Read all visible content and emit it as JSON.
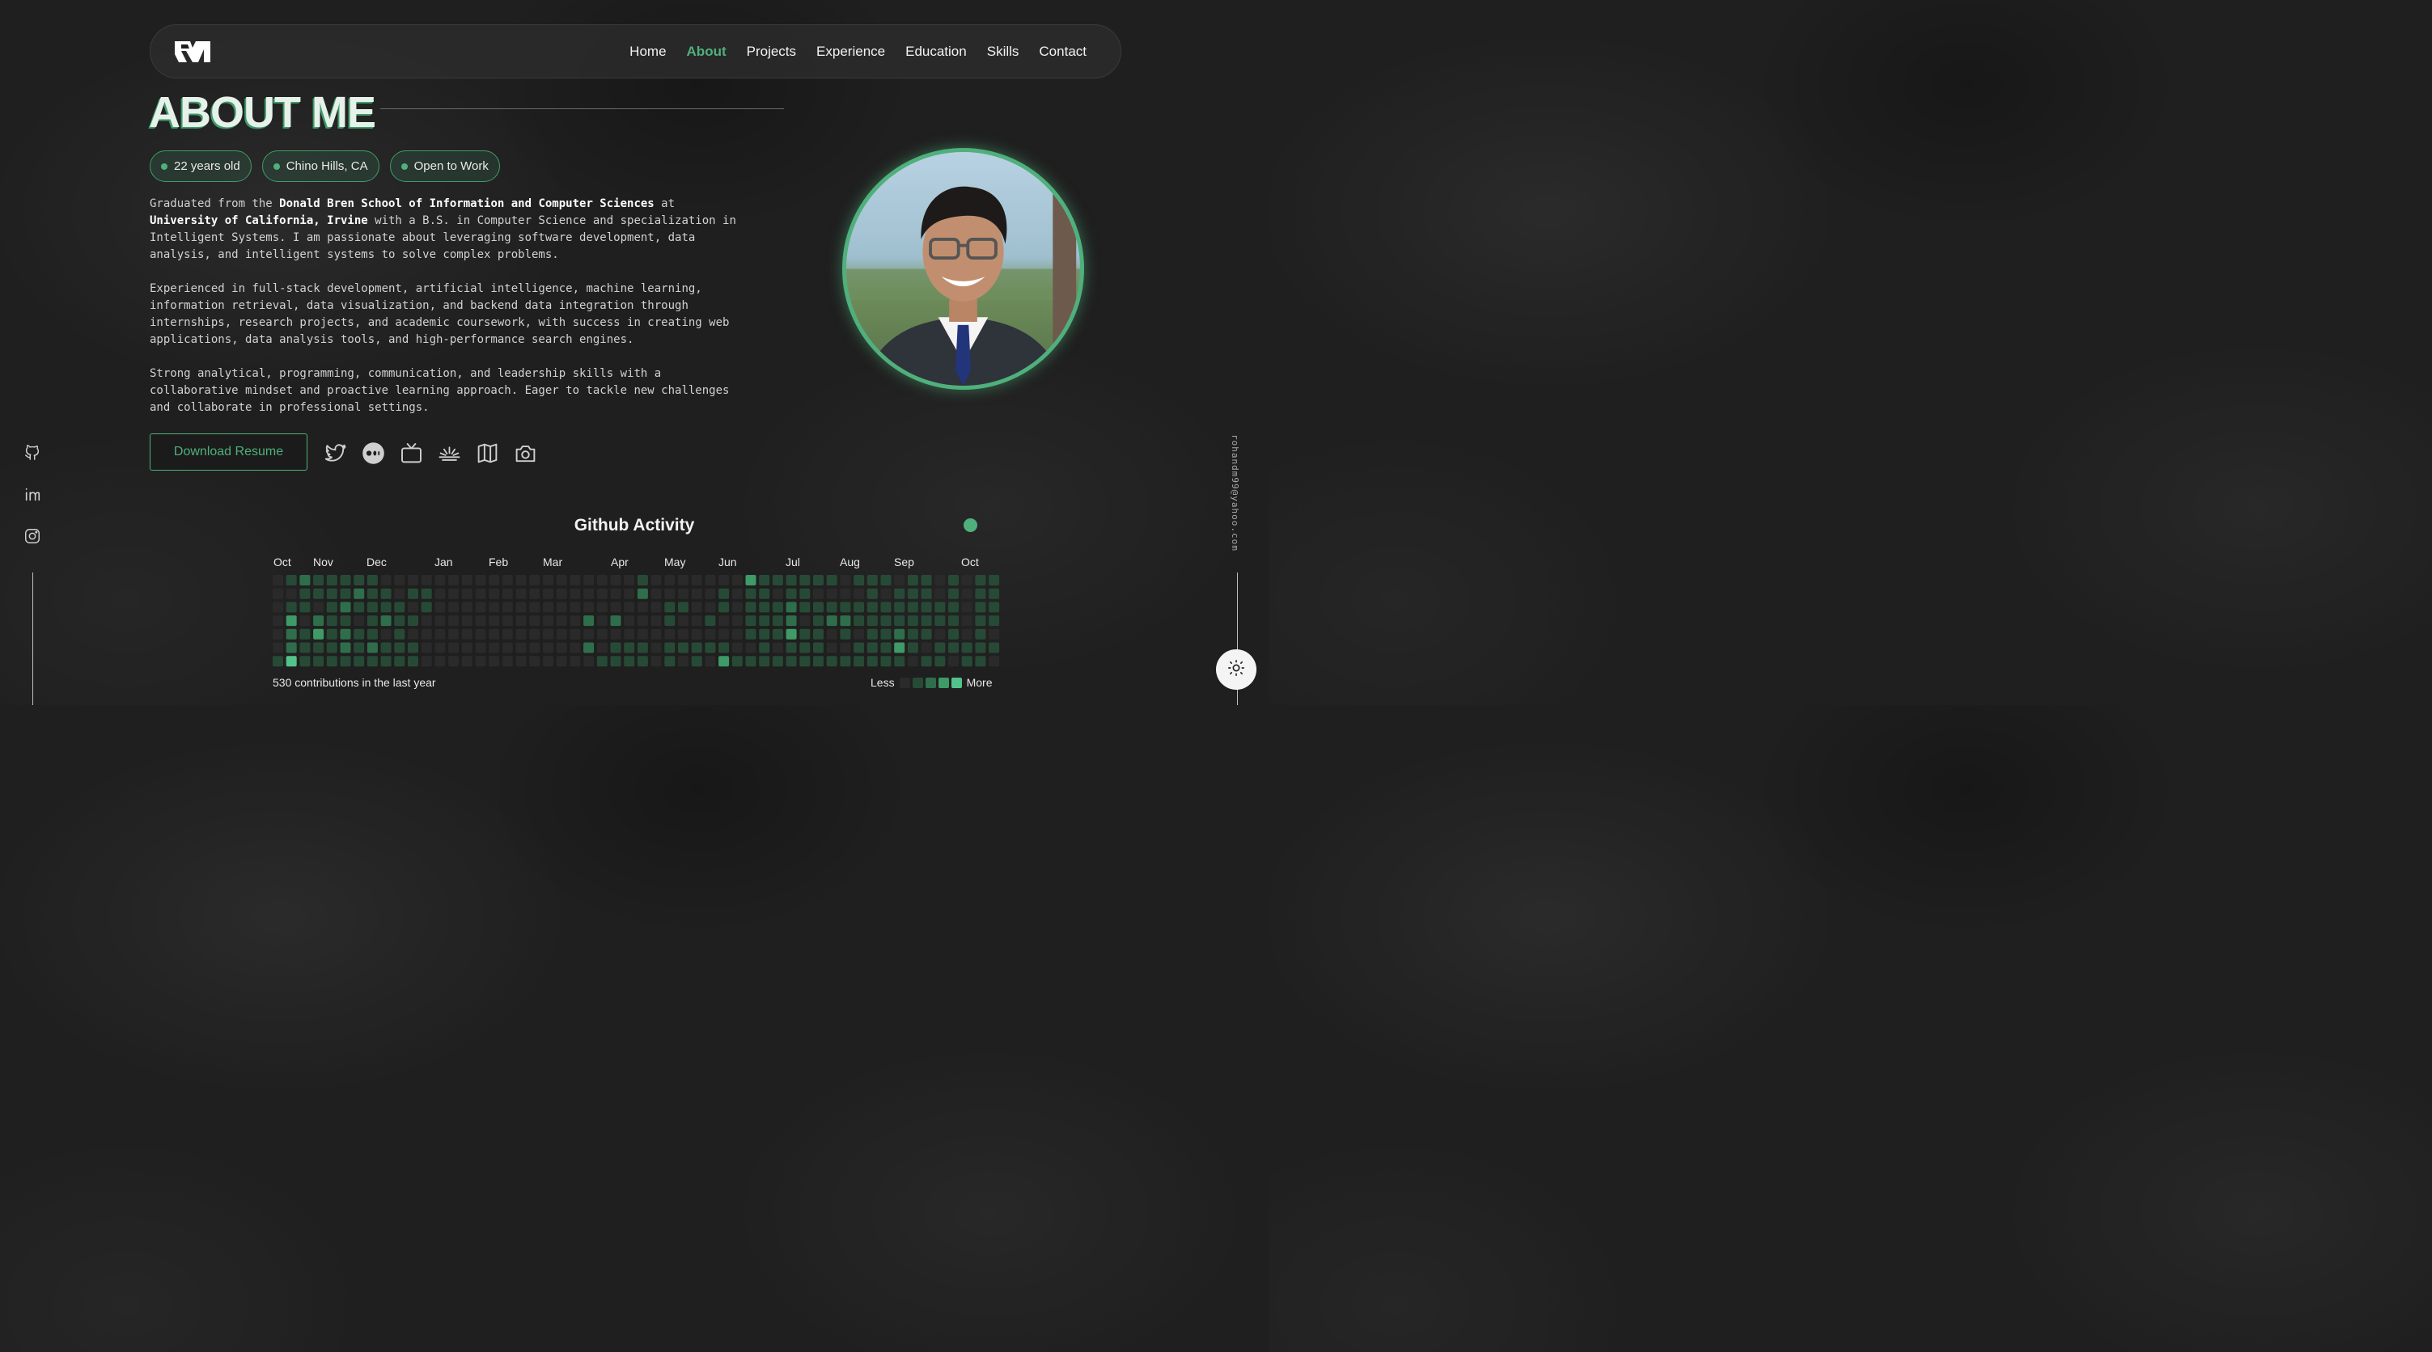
{
  "nav": {
    "logo_icon": "rm-monogram-logo",
    "links": [
      {
        "label": "Home",
        "active": false
      },
      {
        "label": "About",
        "active": true
      },
      {
        "label": "Projects",
        "active": false
      },
      {
        "label": "Experience",
        "active": false
      },
      {
        "label": "Education",
        "active": false
      },
      {
        "label": "Skills",
        "active": false
      },
      {
        "label": "Contact",
        "active": false
      }
    ]
  },
  "about": {
    "title": "ABOUT ME",
    "badges": [
      "22 years old",
      "Chino Hills, CA",
      "Open to Work"
    ],
    "paragraph1": {
      "t1": "Graduated from the ",
      "b1": "Donald Bren School of Information and Computer Sciences",
      "t2": " at\n",
      "b2": "University of California, Irvine",
      "t3": " with a B.S. in Computer Science and specialization in\nIntelligent Systems. I am passionate about leveraging software development, data\nanalysis, and intelligent systems to solve complex problems."
    },
    "paragraph2": "Experienced in full-stack development, artificial intelligence, machine learning,\ninformation retrieval, data visualization, and backend data integration through\ninternships, research projects, and academic coursework, with success in creating web\napplications, data analysis tools, and high-performance search engines.",
    "paragraph3": "Strong analytical, programming, communication, and leadership skills with a\ncollaborative mindset and proactive learning approach. Eager to tackle new challenges\nand collaborate in professional settings.",
    "resume_button": "Download Resume",
    "profile_icons": [
      "twitter-icon",
      "medium-icon",
      "tv-icon",
      "sunrise-icon",
      "map-icon",
      "camera-icon"
    ],
    "photo_alt": "profile-photo"
  },
  "sidebar": {
    "icons": [
      "github-icon",
      "linkedin-icon",
      "instagram-icon"
    ],
    "email": "rohandm99@yahoo.com"
  },
  "theme_toggle_icon": "sun-icon",
  "github": {
    "title": "Github Activity",
    "months": [
      "Oct",
      "Nov",
      "Dec",
      "Jan",
      "Feb",
      "Mar",
      "Apr",
      "May",
      "Jun",
      "Jul",
      "Aug",
      "Sep",
      "Oct"
    ],
    "total_label": "530 contributions in the last year",
    "legend_less": "Less",
    "legend_more": "More",
    "colors": [
      "#2a2a2a",
      "#274a37",
      "#2f6e4b",
      "#3e9a66",
      "#52c48a"
    ],
    "weeks": [
      [
        0,
        0,
        0,
        0,
        0,
        0,
        1
      ],
      [
        1,
        0,
        1,
        3,
        2,
        2,
        4
      ],
      [
        2,
        1,
        1,
        0,
        1,
        1,
        1
      ],
      [
        1,
        1,
        0,
        2,
        3,
        1,
        1
      ],
      [
        1,
        1,
        1,
        1,
        1,
        1,
        1
      ],
      [
        1,
        1,
        2,
        1,
        2,
        2,
        1
      ],
      [
        1,
        2,
        1,
        0,
        1,
        1,
        1
      ],
      [
        1,
        1,
        1,
        1,
        1,
        2,
        1
      ],
      [
        0,
        1,
        1,
        2,
        0,
        1,
        1
      ],
      [
        0,
        0,
        1,
        1,
        1,
        1,
        1
      ],
      [
        0,
        1,
        0,
        1,
        0,
        1,
        1
      ],
      [
        0,
        1,
        1,
        0,
        0,
        0,
        0
      ],
      [
        0,
        0,
        0,
        0,
        0,
        0,
        0
      ],
      [
        0,
        0,
        0,
        0,
        0,
        0,
        0
      ],
      [
        0,
        0,
        0,
        0,
        0,
        0,
        0
      ],
      [
        0,
        0,
        0,
        0,
        0,
        0,
        0
      ],
      [
        0,
        0,
        0,
        0,
        0,
        0,
        0
      ],
      [
        0,
        0,
        0,
        0,
        0,
        0,
        0
      ],
      [
        0,
        0,
        0,
        0,
        0,
        0,
        0
      ],
      [
        0,
        0,
        0,
        0,
        0,
        0,
        0
      ],
      [
        0,
        0,
        0,
        0,
        0,
        0,
        0
      ],
      [
        0,
        0,
        0,
        0,
        0,
        0,
        0
      ],
      [
        0,
        0,
        0,
        0,
        0,
        0,
        0
      ],
      [
        0,
        0,
        0,
        2,
        0,
        2,
        0
      ],
      [
        0,
        0,
        0,
        0,
        0,
        0,
        1
      ],
      [
        0,
        0,
        0,
        2,
        0,
        1,
        1
      ],
      [
        0,
        0,
        0,
        0,
        0,
        1,
        1
      ],
      [
        1,
        2,
        0,
        0,
        0,
        1,
        1
      ],
      [
        0,
        0,
        0,
        0,
        0,
        0,
        0
      ],
      [
        0,
        0,
        1,
        1,
        0,
        1,
        1
      ],
      [
        0,
        0,
        1,
        0,
        0,
        1,
        0
      ],
      [
        0,
        0,
        0,
        0,
        0,
        1,
        1
      ],
      [
        0,
        0,
        0,
        1,
        0,
        1,
        0
      ],
      [
        0,
        1,
        1,
        0,
        0,
        1,
        3
      ],
      [
        0,
        0,
        0,
        0,
        0,
        0,
        1
      ],
      [
        3,
        1,
        1,
        1,
        1,
        0,
        1
      ],
      [
        1,
        1,
        1,
        1,
        1,
        1,
        1
      ],
      [
        1,
        0,
        1,
        1,
        1,
        0,
        1
      ],
      [
        1,
        1,
        2,
        2,
        3,
        1,
        1
      ],
      [
        1,
        1,
        1,
        0,
        1,
        1,
        1
      ],
      [
        1,
        0,
        1,
        1,
        1,
        1,
        1
      ],
      [
        1,
        0,
        1,
        2,
        0,
        0,
        1
      ],
      [
        0,
        0,
        1,
        2,
        1,
        0,
        1
      ],
      [
        1,
        0,
        1,
        1,
        0,
        1,
        1
      ],
      [
        1,
        1,
        1,
        1,
        1,
        1,
        1
      ],
      [
        1,
        0,
        1,
        1,
        1,
        1,
        1
      ],
      [
        0,
        1,
        1,
        1,
        2,
        3,
        1
      ],
      [
        1,
        1,
        1,
        1,
        1,
        1,
        0
      ],
      [
        1,
        1,
        1,
        1,
        1,
        0,
        1
      ],
      [
        0,
        0,
        1,
        1,
        0,
        1,
        1
      ],
      [
        1,
        1,
        1,
        1,
        1,
        1,
        0
      ],
      [
        0,
        0,
        0,
        0,
        0,
        1,
        1
      ],
      [
        1,
        1,
        1,
        1,
        1,
        1,
        1
      ],
      [
        1,
        1,
        1,
        1,
        0,
        1,
        0
      ]
    ]
  }
}
